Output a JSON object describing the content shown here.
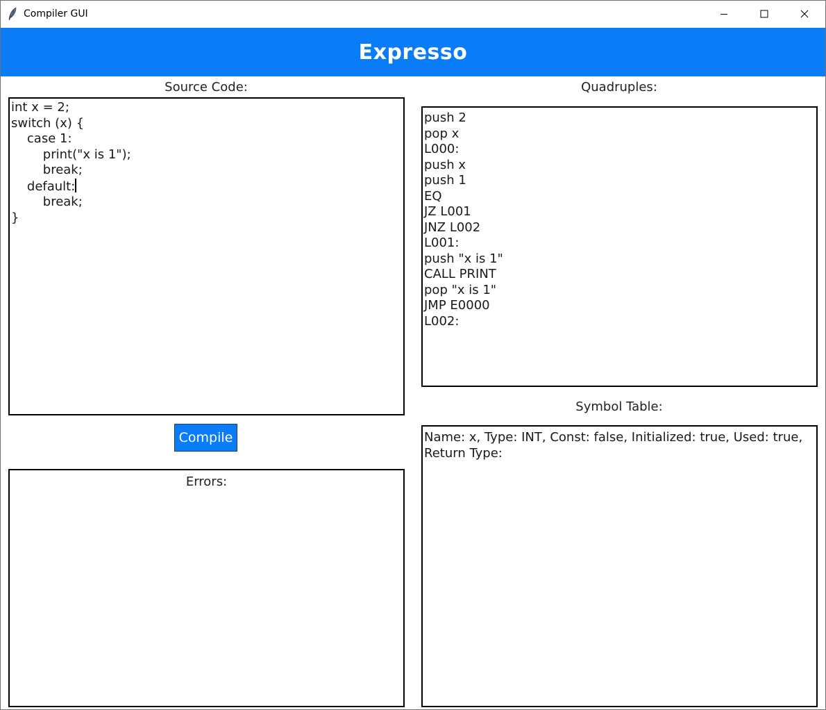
{
  "window": {
    "title": "Compiler GUI",
    "app_icon": "feather-icon",
    "controls": [
      "minimize-icon",
      "maximize-icon",
      "close-icon"
    ]
  },
  "header": {
    "title": "Expresso",
    "color": "#0a7cf7"
  },
  "source": {
    "label": "Source Code:",
    "lines": [
      "int x = 2;",
      "switch (x) {",
      "    case 1:",
      "        print(\"x is 1\");",
      "        break;",
      "    default:",
      "        break;",
      "}"
    ]
  },
  "compile": {
    "label": "Compile"
  },
  "errors": {
    "label": "Errors:"
  },
  "quadruples": {
    "label": "Quadruples:",
    "lines": [
      "push 2",
      "pop x",
      "L000:",
      "push x",
      "push 1",
      "EQ",
      "JZ L001",
      "JNZ L002",
      "L001:",
      "push \"x is 1\"",
      "CALL PRINT",
      "pop \"x is 1\"",
      "JMP E0000",
      "L002:"
    ]
  },
  "symbol_table": {
    "label": "Symbol Table:",
    "text": "Name: x, Type: INT, Const: false, Initialized: true, Used: true, Return Type:"
  }
}
